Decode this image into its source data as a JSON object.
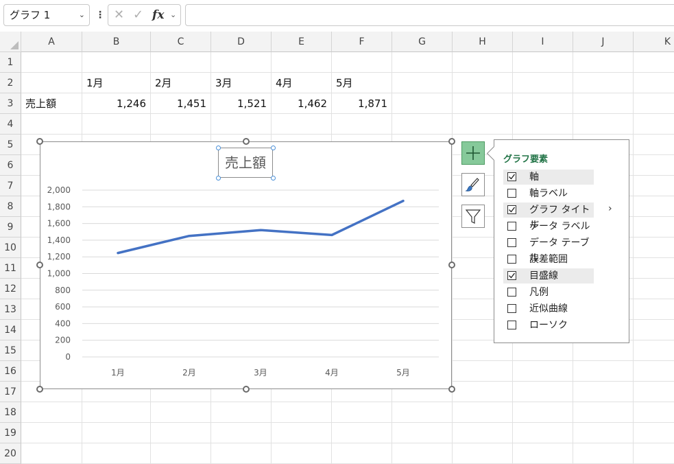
{
  "formula_bar": {
    "name_box": "グラフ 1",
    "cancel_icon": "x-icon",
    "enter_icon": "check-icon",
    "fx_label": "fx",
    "formula": ""
  },
  "columns": [
    "A",
    "B",
    "C",
    "D",
    "E",
    "F",
    "G",
    "H",
    "I",
    "J",
    "K"
  ],
  "rows": [
    "1",
    "2",
    "3",
    "4",
    "5",
    "6",
    "7",
    "8",
    "9",
    "10",
    "11",
    "12",
    "13",
    "14",
    "15",
    "16",
    "17",
    "18",
    "19",
    "20"
  ],
  "cells": {
    "B2": "1月",
    "C2": "2月",
    "D2": "3月",
    "E2": "4月",
    "F2": "5月",
    "A3": "売上額",
    "B3": "1,246",
    "C3": "1,451",
    "D3": "1,521",
    "E3": "1,462",
    "F3": "1,871"
  },
  "chart_data": {
    "type": "line",
    "title": "売上額",
    "categories": [
      "1月",
      "2月",
      "3月",
      "4月",
      "5月"
    ],
    "series": [
      {
        "values": [
          1246,
          1451,
          1521,
          1462,
          1871
        ],
        "color": "#4472c4"
      }
    ],
    "ylim": [
      0,
      2000
    ],
    "yticks": [
      0,
      200,
      400,
      600,
      800,
      1000,
      1200,
      1400,
      1600,
      1800,
      2000
    ],
    "ytick_labels": [
      "0",
      "200",
      "400",
      "600",
      "800",
      "1,000",
      "1,200",
      "1,400",
      "1,600",
      "1,800",
      "2,000"
    ],
    "grid": true,
    "legend": "none"
  },
  "chart_tools": {
    "elements_icon": "plus-icon",
    "styles_icon": "brush-icon",
    "filter_icon": "filter-icon"
  },
  "chart_elements_panel": {
    "title": "グラフ要素",
    "items": [
      {
        "label": "軸",
        "checked": true
      },
      {
        "label": "軸ラベル",
        "checked": false
      },
      {
        "label": "グラフ タイトル",
        "checked": true
      },
      {
        "label": "データ ラベル",
        "checked": false
      },
      {
        "label": "データ テーブル",
        "checked": false
      },
      {
        "label": "誤差範囲",
        "checked": false
      },
      {
        "label": "目盛線",
        "checked": true
      },
      {
        "label": "凡例",
        "checked": false
      },
      {
        "label": "近似曲線",
        "checked": false
      },
      {
        "label": "ローソク",
        "checked": false
      }
    ],
    "more_icon": "chevron-right-icon"
  }
}
